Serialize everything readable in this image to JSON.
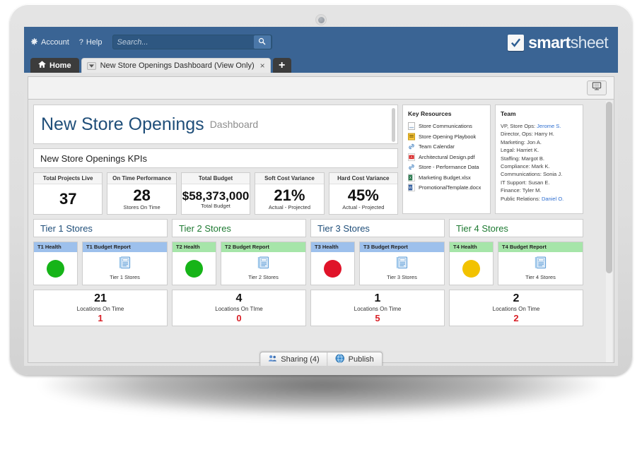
{
  "app": {
    "account_label": "Account",
    "help_label": "Help",
    "search": {
      "placeholder": "Search...",
      "value": ""
    },
    "logo": {
      "brand_bold": "smart",
      "brand_light": "sheet",
      "check_glyph": "check-icon"
    },
    "colors": {
      "header_blue": "#3a6494",
      "title_blue": "#1f4e79",
      "tier_green": "#1e7a32",
      "alert_red": "#d91f26"
    }
  },
  "tabs": {
    "home_label": "Home",
    "document_label": "New Store Openings Dashboard (View Only)",
    "close_glyph": "×",
    "add_glyph": "+"
  },
  "dashboard": {
    "title_main": "New Store Openings",
    "title_sub": "Dashboard",
    "kpi_section_header": "New Store Openings KPIs",
    "kpis": [
      {
        "title": "Total Projects Live",
        "value": "37",
        "note": ""
      },
      {
        "title": "On Time Performance",
        "value": "28",
        "note": "Stores On Time"
      },
      {
        "title": "Total Budget",
        "value": "$58,373,000",
        "note": "Total Budget"
      },
      {
        "title": "Soft Cost Variance",
        "value": "21%",
        "note": "Actual - Projected"
      },
      {
        "title": "Hard Cost Variance",
        "value": "45%",
        "note": "Actual - Projected"
      }
    ],
    "key_resources": {
      "heading": "Key Resources",
      "items": [
        {
          "label": "Store Communications",
          "icon": "sheet-icon"
        },
        {
          "label": "Store Opening Playbook",
          "icon": "report-icon"
        },
        {
          "label": "Team Calendar",
          "icon": "link-icon"
        },
        {
          "label": "Architectural Design.pdf",
          "icon": "pdf-icon"
        },
        {
          "label": "Store - Performance Data",
          "icon": "link-icon"
        },
        {
          "label": "Marketing Budget.xlsx",
          "icon": "excel-icon"
        },
        {
          "label": "PromotionalTemplate.docx",
          "icon": "word-icon"
        }
      ]
    },
    "team": {
      "heading": "Team",
      "members": [
        {
          "role": "VP, Store Ops:",
          "name": "Jerome S.",
          "link": true
        },
        {
          "role": "Director, Ops:",
          "name": "Harry H.",
          "link": false
        },
        {
          "role": "Marketing:",
          "name": "Jon A.",
          "link": false
        },
        {
          "role": "Legal:",
          "name": "Harriet K.",
          "link": false
        },
        {
          "role": "Staffing:",
          "name": "Margot B.",
          "link": false
        },
        {
          "role": "Compliance:",
          "name": "Mark K.",
          "link": false
        },
        {
          "role": "Communications:",
          "name": "Sonia J.",
          "link": false
        },
        {
          "role": "IT Support:",
          "name": "Susan E.",
          "link": false
        },
        {
          "role": "Finance:",
          "name": "Tyler M.",
          "link": false
        },
        {
          "role": "Public Relations:",
          "name": "Daniel O.",
          "link": true
        }
      ]
    },
    "tiers": [
      {
        "title": "Tier 1 Stores",
        "title_color": "blue",
        "header_color": "blue",
        "health_label": "T1 Health",
        "health_color": "#16b418",
        "report_label": "T1 Budget Report",
        "report_link": "Tier 1 Stores",
        "on_time_value": "21",
        "on_time_label": "Locations On Time",
        "alert_value": "1"
      },
      {
        "title": "Tier 2 Stores",
        "title_color": "green",
        "header_color": "green",
        "health_label": "T2 Health",
        "health_color": "#16b418",
        "report_label": "T2 Budget Report",
        "report_link": "Tier 2 Stores",
        "on_time_value": "4",
        "on_time_label": "Locations On TIme",
        "alert_value": "0"
      },
      {
        "title": "Tier 3 Stores",
        "title_color": "blue",
        "header_color": "blue",
        "health_label": "T3 Health",
        "health_color": "#e01329",
        "report_label": "T3 Budget Report",
        "report_link": "Tier 3 Stores",
        "on_time_value": "1",
        "on_time_label": "Locations On Time",
        "alert_value": "5"
      },
      {
        "title": "Tier 4 Stores",
        "title_color": "green",
        "header_color": "green",
        "health_label": "T4 Health",
        "health_color": "#f2c200",
        "report_label": "T4 Budget Report",
        "report_link": "Tier 4 Stores",
        "on_time_value": "2",
        "on_time_label": "Locations On Time",
        "alert_value": "2"
      }
    ],
    "toolbar": {
      "view_mode_icon": "monitor-icon"
    }
  },
  "footer": {
    "sharing_label": "Sharing (4)",
    "publish_label": "Publish"
  }
}
